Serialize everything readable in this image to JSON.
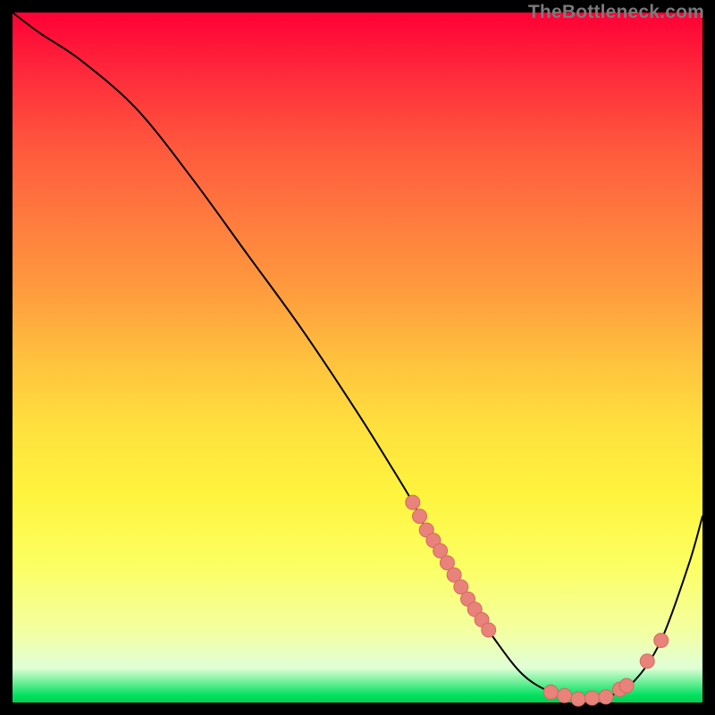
{
  "attribution": "TheBottleneck.com",
  "colors": {
    "curve_stroke": "#000000",
    "dot_fill": "#e9827a",
    "dot_stroke": "#d46a60"
  },
  "chart_data": {
    "type": "line",
    "title": "",
    "xlabel": "",
    "ylabel": "",
    "xlim": [
      0,
      100
    ],
    "ylim": [
      0,
      100
    ],
    "grid": false,
    "series": [
      {
        "name": "bottleneck_curve",
        "x": [
          0,
          4,
          10,
          18,
          26,
          34,
          42,
          50,
          55,
          58,
          60,
          62,
          66,
          70,
          74,
          78,
          82,
          86,
          90,
          94,
          98,
          100
        ],
        "y": [
          100,
          97,
          93,
          86,
          76,
          65,
          54,
          42,
          34,
          29,
          25,
          22,
          15,
          9,
          4,
          1.5,
          0.5,
          0.8,
          3,
          9,
          20,
          27
        ]
      }
    ],
    "scatter_on_curve_x": [
      58,
      59,
      60,
      61,
      62,
      63,
      64,
      65,
      66,
      67,
      68,
      69,
      78,
      80,
      82,
      84,
      86,
      88,
      89,
      92,
      94
    ]
  }
}
